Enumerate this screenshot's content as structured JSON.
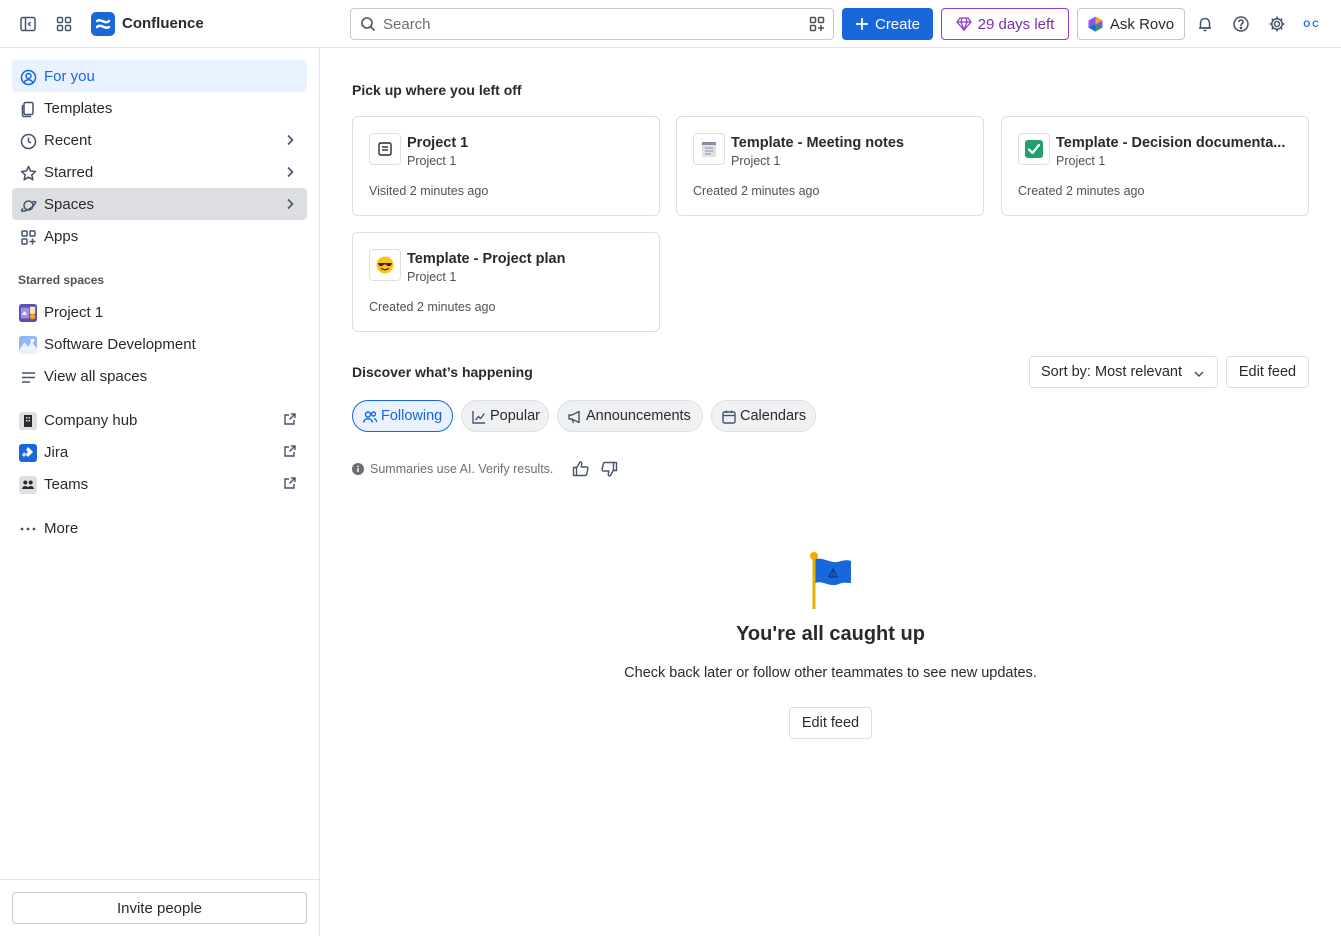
{
  "app": {
    "name": "Confluence"
  },
  "topbar": {
    "search_placeholder": "Search",
    "create_label": "Create",
    "trial_label": "29 days left",
    "rovo_label": "Ask Rovo",
    "avatar_initials": "OC"
  },
  "sidebar": {
    "items": [
      {
        "label": "For you"
      },
      {
        "label": "Templates"
      },
      {
        "label": "Recent"
      },
      {
        "label": "Starred"
      },
      {
        "label": "Spaces"
      },
      {
        "label": "Apps"
      }
    ],
    "starred_heading": "Starred spaces",
    "starred_spaces": [
      {
        "label": "Project 1"
      },
      {
        "label": "Software Development"
      },
      {
        "label": "View all spaces"
      }
    ],
    "links": [
      {
        "label": "Company hub"
      },
      {
        "label": "Jira"
      },
      {
        "label": "Teams"
      }
    ],
    "more_label": "More",
    "invite_label": "Invite people"
  },
  "main": {
    "recent_heading": "Pick up where you left off",
    "cards": [
      {
        "title": "Project 1",
        "space": "Project 1",
        "meta": "Visited 2 minutes ago",
        "icon": "page-icon"
      },
      {
        "title": "Template - Meeting notes",
        "space": "Project 1",
        "meta": "Created 2 minutes ago",
        "icon": "notepad-emoji"
      },
      {
        "title": "Template - Decision documenta...",
        "space": "Project 1",
        "meta": "Created 2 minutes ago",
        "icon": "checkmark-emoji"
      },
      {
        "title": "Template - Project plan",
        "space": "Project 1",
        "meta": "Created 2 minutes ago",
        "icon": "sunglasses-emoji"
      }
    ],
    "discover_heading": "Discover what’s happening",
    "sort_label": "Sort by: Most relevant",
    "edit_feed_label": "Edit feed",
    "chips": [
      {
        "label": "Following"
      },
      {
        "label": "Popular"
      },
      {
        "label": "Announcements"
      },
      {
        "label": "Calendars"
      }
    ],
    "ai_note": "Summaries use AI. Verify results.",
    "empty_title": "You're all caught up",
    "empty_subtitle": "Check back later or follow other teammates to see new updates.",
    "empty_button": "Edit feed"
  },
  "colors": {
    "brand": "#1868db",
    "trial": "#8f3fc9",
    "active_bg": "#e9f2fe"
  }
}
